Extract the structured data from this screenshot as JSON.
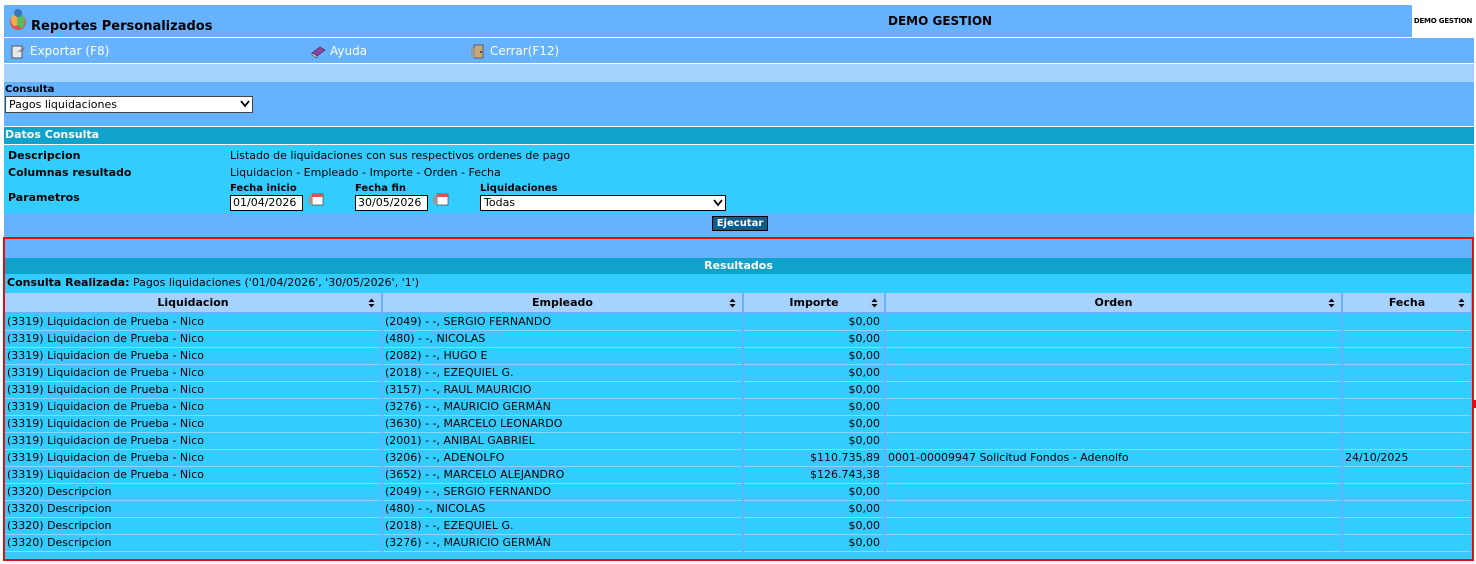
{
  "header": {
    "title": "Reportes Personalizados",
    "company": "DEMO GESTION",
    "company_logo_text": "DEMO GESTION"
  },
  "toolbar": {
    "export_label": "Exportar (F8)",
    "help_label": "Ayuda",
    "close_label": "Cerrar(F12)"
  },
  "consulta": {
    "label": "Consulta",
    "selected": "Pagos liquidaciones"
  },
  "datos": {
    "header": "Datos Consulta",
    "descripcion_label": "Descripcion",
    "descripcion_value": "Listado de liquidaciones con sus respectivos ordenes de pago",
    "columnas_label": "Columnas resultado",
    "columnas_value": "Liquidacion - Empleado - Importe - Orden - Fecha",
    "parametros_label": "Parametros",
    "fecha_inicio_label": "Fecha inicio",
    "fecha_inicio_value": "01/04/2026",
    "fecha_fin_label": "Fecha fin",
    "fecha_fin_value": "30/05/2026",
    "liquidaciones_label": "Liquidaciones",
    "liquidaciones_value": "Todas",
    "ejecutar_label": "Ejecutar"
  },
  "results": {
    "title": "Resultados",
    "consulta_realizada_label": "Consulta Realizada:",
    "consulta_realizada_value": "Pagos liquidaciones ('01/04/2026', '30/05/2026', '1')",
    "columns": [
      "Liquidacion",
      "Empleado",
      "Importe",
      "Orden",
      "Fecha"
    ],
    "rows": [
      [
        "(3319) Liquidacion de Prueba - Nico",
        "(2049) - -, SERGIO FERNANDO",
        "$0,00",
        "",
        ""
      ],
      [
        "(3319) Liquidacion de Prueba - Nico",
        "(480) - -, NICOLAS",
        "$0,00",
        "",
        ""
      ],
      [
        "(3319) Liquidacion de Prueba - Nico",
        "(2082) - -, HUGO E",
        "$0,00",
        "",
        ""
      ],
      [
        "(3319) Liquidacion de Prueba - Nico",
        "(2018) - -, EZEQUIEL G.",
        "$0,00",
        "",
        ""
      ],
      [
        "(3319) Liquidacion de Prueba - Nico",
        "(3157) - -, RAUL MAURICIO",
        "$0,00",
        "",
        ""
      ],
      [
        "(3319) Liquidacion de Prueba - Nico",
        "(3276) - -, MAURICIO GERMÁN",
        "$0,00",
        "",
        ""
      ],
      [
        "(3319) Liquidacion de Prueba - Nico",
        "(3630) - -, MARCELO LEONARDO",
        "$0,00",
        "",
        ""
      ],
      [
        "(3319) Liquidacion de Prueba - Nico",
        "(2001) - -, ANIBAL GABRIEL",
        "$0,00",
        "",
        ""
      ],
      [
        "(3319) Liquidacion de Prueba - Nico",
        "(3206) - -, ADENOLFO",
        "$110.735,89",
        "0001-00009947 Solicitud Fondos - Adenolfo",
        "24/10/2025"
      ],
      [
        "(3319) Liquidacion de Prueba - Nico",
        "(3652) - -, MARCELO ALEJANDRO",
        "$126.743,38",
        "",
        ""
      ],
      [
        "(3320) Descripcion",
        "(2049) - -, SERGIO FERNANDO",
        "$0,00",
        "",
        ""
      ],
      [
        "(3320) Descripcion",
        "(480) - -, NICOLAS",
        "$0,00",
        "",
        ""
      ],
      [
        "(3320) Descripcion",
        "(2018) - -, EZEQUIEL G.",
        "$0,00",
        "",
        ""
      ],
      [
        "(3320) Descripcion",
        "(3276) - -, MAURICIO GERMÁN",
        "$0,00",
        "",
        ""
      ]
    ]
  },
  "colors": {
    "header_blue": "#66b2ff",
    "section_teal": "#0fa3cc",
    "body_cyan": "#33ccff",
    "highlight_red": "#e01010"
  }
}
